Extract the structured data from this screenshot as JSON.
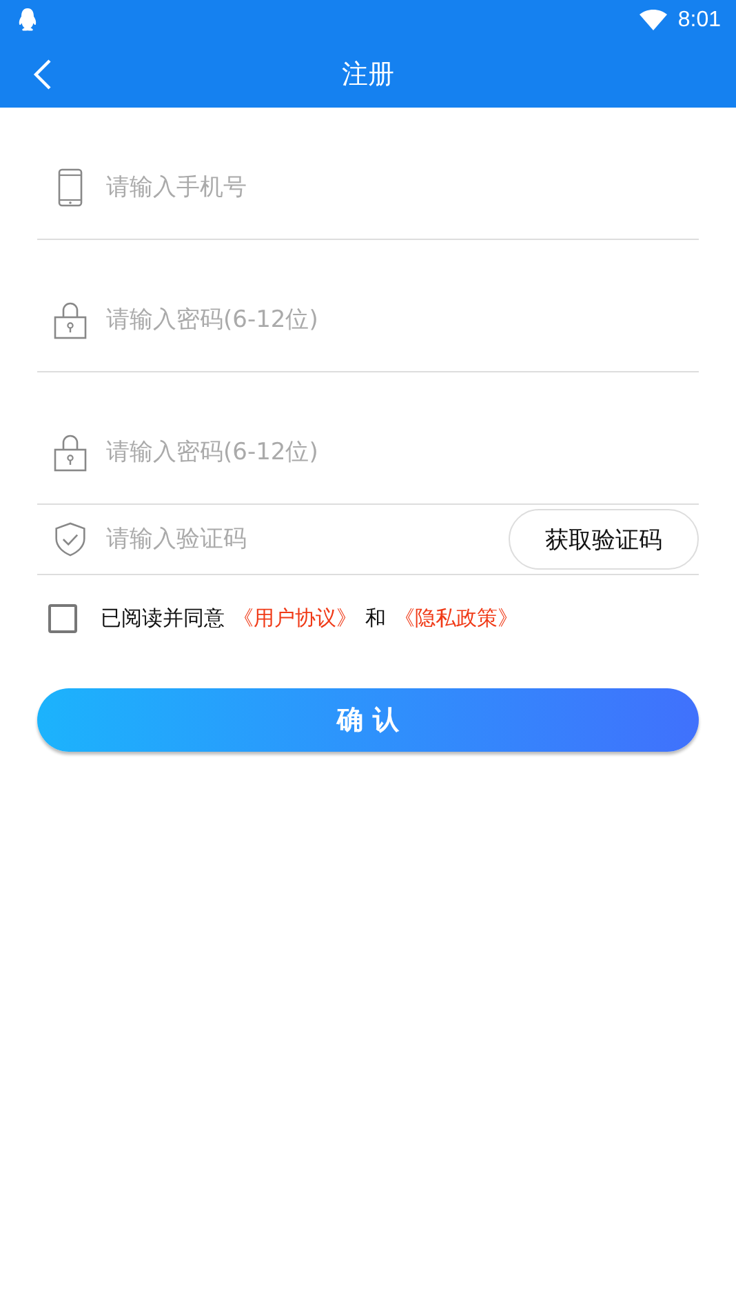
{
  "status_bar": {
    "time": "8:01"
  },
  "header": {
    "title": "注册"
  },
  "fields": [
    {
      "kind": "phone",
      "placeholder": "请输入手机号"
    },
    {
      "kind": "lock",
      "placeholder": "请输入密码(6-12位)"
    },
    {
      "kind": "lock",
      "placeholder": "请输入密码(6-12位)"
    },
    {
      "kind": "shield",
      "placeholder": "请输入验证码",
      "button": "获取验证码"
    }
  ],
  "agreement": {
    "checked": false,
    "parts": [
      {
        "kind": "text",
        "text": "已阅读并同意"
      },
      {
        "kind": "link",
        "text": "《用户协议》"
      },
      {
        "kind": "text",
        "text": "和"
      },
      {
        "kind": "link",
        "text": "《隐私政策》"
      }
    ]
  },
  "confirm": "确 认"
}
